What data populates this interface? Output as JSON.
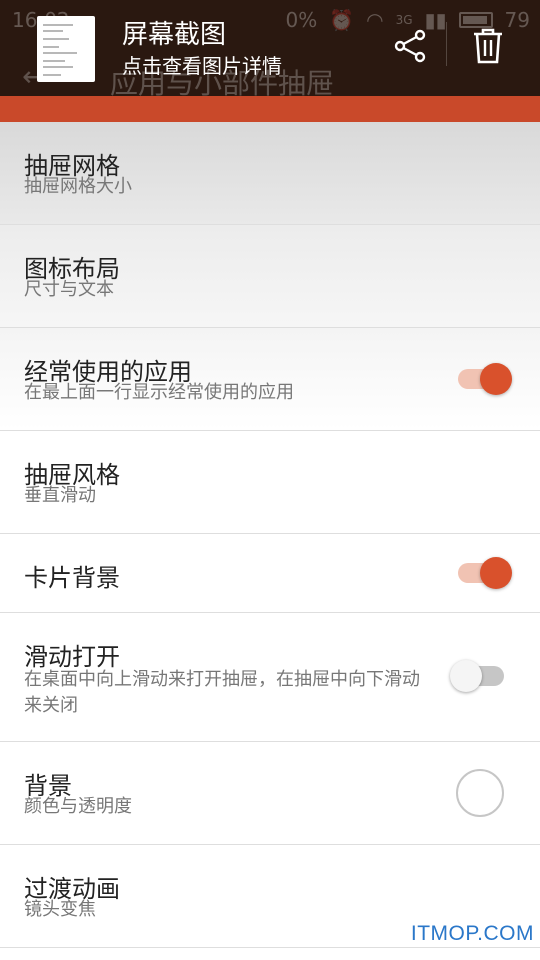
{
  "status_bar": {
    "time": "16:02",
    "signal_text": "0%",
    "network": "3G",
    "battery": "79"
  },
  "notification": {
    "title": "屏幕截图",
    "subtitle": "点击查看图片详情",
    "share_icon": "share-icon",
    "delete_icon": "trash-icon"
  },
  "toolbar": {
    "back_icon": "back-arrow-icon",
    "title": "应用与小部件抽屉"
  },
  "accent_color": "#c9492a",
  "settings": {
    "items": [
      {
        "title": "抽屉网格",
        "subtitle": "抽屉网格大小"
      },
      {
        "title": "图标布局",
        "subtitle": "尺寸与文本"
      },
      {
        "title": "经常使用的应用",
        "subtitle": "在最上面一行显示经常使用的应用",
        "control": "switch",
        "checked": true
      },
      {
        "title": "抽屉风格",
        "subtitle": "垂直滑动"
      },
      {
        "title": "卡片背景",
        "control": "switch",
        "checked": true
      },
      {
        "title": "滑动打开",
        "subtitle": "在桌面中向上滑动来打开抽屉，在抽屉中向下滑动来关闭",
        "control": "switch",
        "checked": false
      },
      {
        "title": "背景",
        "subtitle": "颜色与透明度",
        "control": "color-swatch"
      },
      {
        "title": "过渡动画",
        "subtitle": "镜头变焦"
      }
    ]
  },
  "watermark": "ITMOP.COM"
}
